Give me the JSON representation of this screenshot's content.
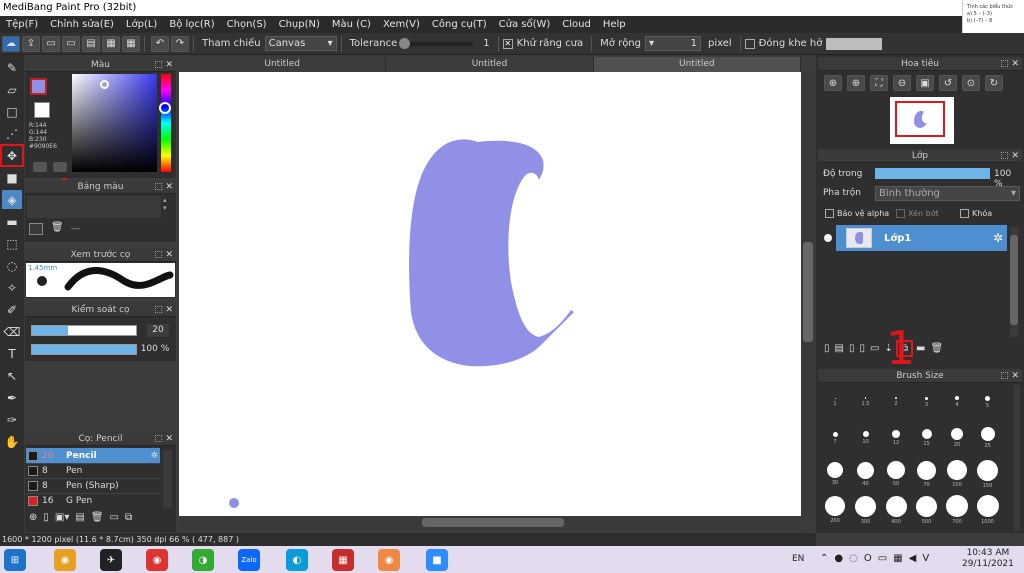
{
  "app": {
    "title": "MediBang Paint Pro (32bit)"
  },
  "menu": [
    "Tệp(F)",
    "Chỉnh sửa(E)",
    "Lớp(L)",
    "Bộ lọc(R)",
    "Chọn(S)",
    "Chụp(N)",
    "Màu (C)",
    "Xem(V)",
    "Công cụ(T)",
    "Cửa sổ(W)",
    "Cloud",
    "Help"
  ],
  "toolbar": {
    "ref_label": "Tham chiếu",
    "ref_value": "Canvas",
    "tolerance_label": "Tolerance",
    "tolerance_value": "1",
    "antialias_label": "Khử răng cưa",
    "expand_label": "Mở rộng",
    "expand_value": "1",
    "expand_unit": "pixel",
    "close_gap_label": "Đóng khe hở"
  },
  "doc_corner": {
    "line1": "Tính các biểu thức",
    "line2": "a)   5 – (–3)",
    "line3": "b)   (–7) – 8"
  },
  "tabs": [
    "Untitled",
    "Untitled",
    "Untitled"
  ],
  "color_panel": {
    "title": "Màu",
    "r": "R:144",
    "g": "G:144",
    "b": "B:230",
    "hex": "#9090E6",
    "fg": "#9090e6"
  },
  "palette_panel": {
    "title": "Bảng màu",
    "dash": "---"
  },
  "brush_preview_panel": {
    "title": "Xem trước cọ",
    "size": "1.45mm"
  },
  "brush_control_panel": {
    "title": "Kiểm soát cọ",
    "size_value": "20",
    "size_fill": 0.35,
    "opacity_value": "100 %",
    "opacity_fill": 1.0
  },
  "brush_list_panel": {
    "title": "Cọ: Pencil",
    "items": [
      {
        "size": "20",
        "name": "Pencil",
        "color": "#1a1a1a"
      },
      {
        "size": "8",
        "name": "Pen",
        "color": "#1a1a1a"
      },
      {
        "size": "8",
        "name": "Pen (Sharp)",
        "color": "#1a1a1a"
      },
      {
        "size": "16",
        "name": "G Pen",
        "color": "#e02020"
      }
    ]
  },
  "navigator_panel": {
    "title": "Hoa tiêu"
  },
  "layer_panel": {
    "title": "Lớp",
    "opacity_label": "Độ trong",
    "opacity_value": "100 %",
    "opacity_fill": 1.0,
    "blend_label": "Pha trộn",
    "blend_value": "Bình thường",
    "protect_alpha": "Bảo vệ alpha",
    "clip": "Xén bớt",
    "lock": "Khóa",
    "layer_name": "Lớp1"
  },
  "brush_size_panel": {
    "title": "Brush Size",
    "sizes": [
      "1",
      "1.5",
      "2",
      "3",
      "4",
      "5",
      "7",
      "10",
      "12",
      "15",
      "20",
      "25",
      "30",
      "40",
      "50",
      "70",
      "100",
      "150",
      "200",
      "300",
      "400",
      "500",
      "700",
      "1000"
    ]
  },
  "status": {
    "text": "1600 * 1200 pixel  (11.6 * 8.7cm)  350 dpi  66 %  ( 477, 887 )"
  },
  "annotations": {
    "left_number": "2",
    "right_number": "1"
  },
  "taskbar": {
    "time": "10:43 AM",
    "date": "29/11/2021",
    "lang": "EN",
    "zalo": "Zalo"
  }
}
